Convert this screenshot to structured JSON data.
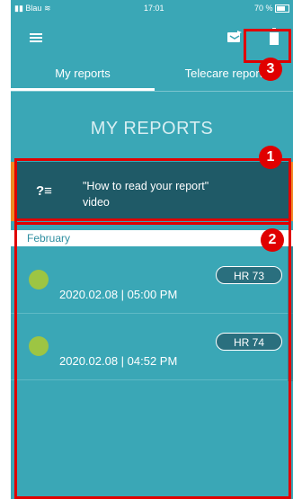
{
  "status_bar": {
    "carrier": "Blau",
    "time": "17:01",
    "battery": "70 %"
  },
  "tabs": [
    {
      "label": "My reports"
    },
    {
      "label": "Telecare report"
    }
  ],
  "page": {
    "title": "MY REPORTS"
  },
  "video_card": {
    "icon_text": "?≡",
    "line1": "\"How to read your report\"",
    "line2": "video"
  },
  "month_header": {
    "label": "February",
    "right_text": "2"
  },
  "reports": [
    {
      "status_color": "#9dc543",
      "datetime": "2020.02.08 | 05:00 PM",
      "hr": "HR 73"
    },
    {
      "status_color": "#9dc543",
      "datetime": "2020.02.08 | 04:52 PM",
      "hr": "HR 74"
    }
  ],
  "annotations": {
    "n1": "1",
    "n2": "2",
    "n3": "3"
  },
  "colors": {
    "primary": "#3aa7b6",
    "card": "#1f5a67",
    "accent": "#f08a24",
    "annotation": "#e00000"
  },
  "icons": [
    "menu-icon",
    "share-icon",
    "trash-icon",
    "video-help-icon"
  ]
}
